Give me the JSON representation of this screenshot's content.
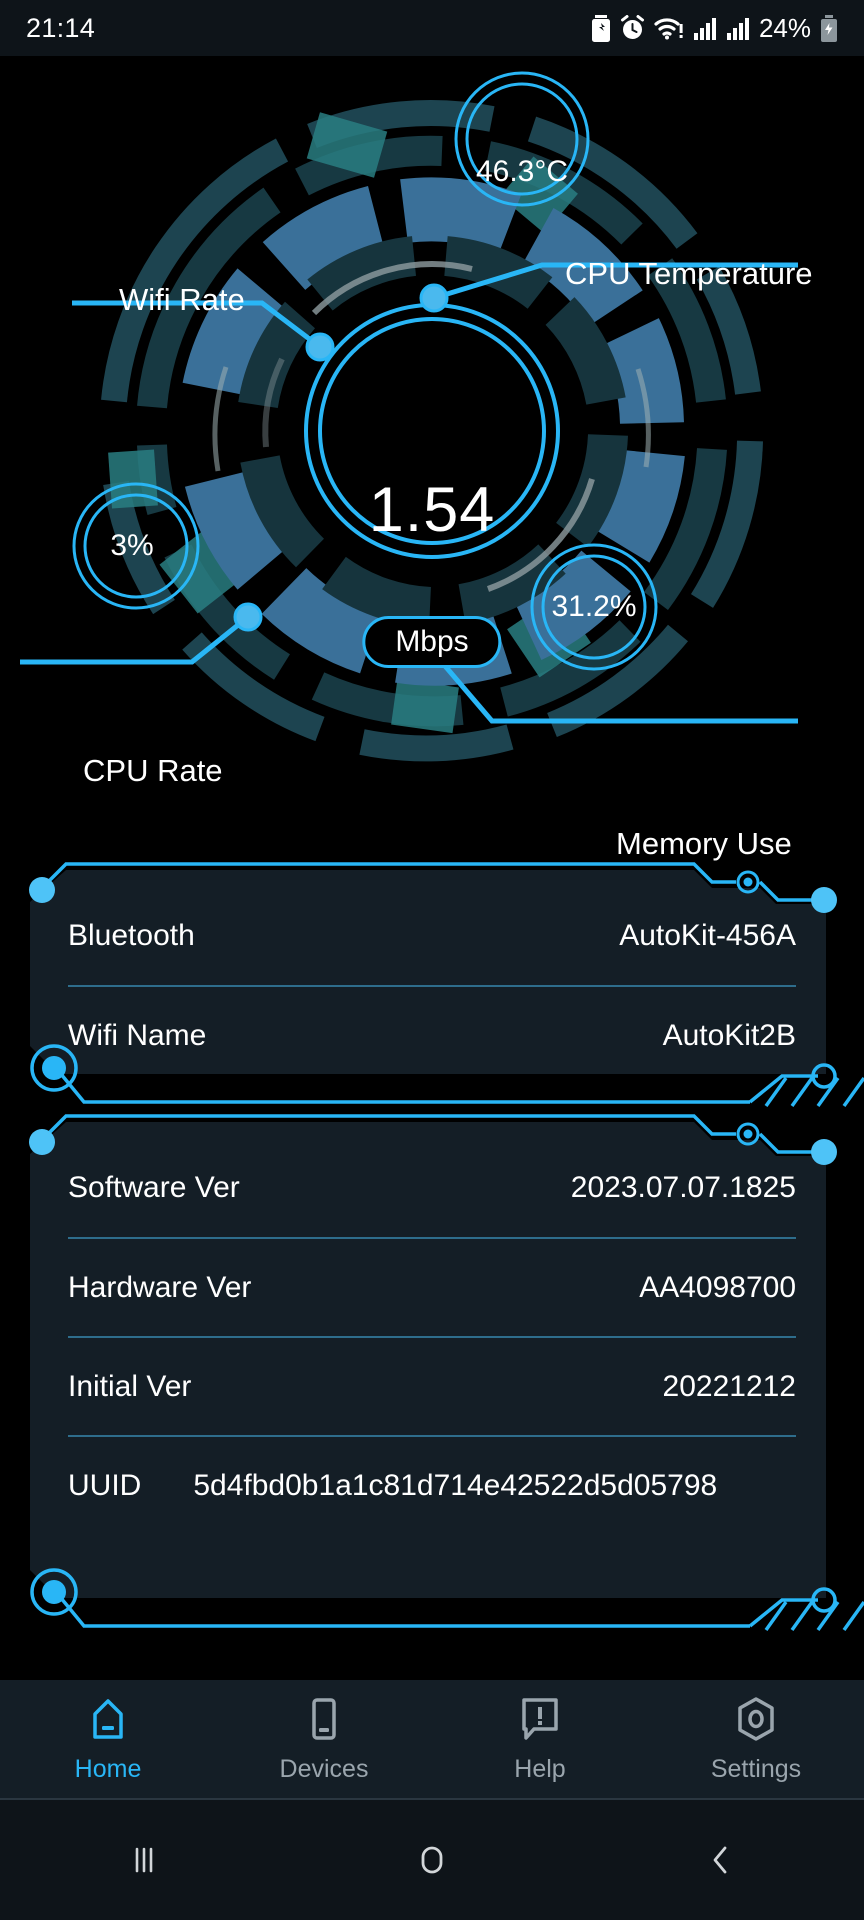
{
  "statusbar": {
    "time": "21:14",
    "battery_percent": "24%",
    "icons": [
      "battery-saver-icon",
      "alarm-icon",
      "wifi-alert-icon",
      "signal-bars-icon",
      "signal-bars-icon",
      "charging-battery-icon"
    ]
  },
  "gauge": {
    "center_value": "1.54",
    "center_unit": "Mbps",
    "metrics": [
      {
        "label": "Wifi Rate",
        "value": "1.54",
        "unit": "Mbps"
      },
      {
        "label": "CPU Temperature",
        "value": "46.3°C"
      },
      {
        "label": "CPU Rate",
        "value": "3%"
      },
      {
        "label": "Memory Use",
        "value": "31.2%"
      }
    ],
    "accent": "#29b6f6",
    "ring_blue": "#3a7099",
    "ring_teal": "#1d4450"
  },
  "cards": [
    {
      "rows": [
        {
          "key": "Bluetooth",
          "value": "AutoKit-456A"
        },
        {
          "key": "Wifi Name",
          "value": "AutoKit2B"
        }
      ]
    },
    {
      "rows": [
        {
          "key": "Software Ver",
          "value": "2023.07.07.1825"
        },
        {
          "key": "Hardware Ver",
          "value": "AA4098700"
        },
        {
          "key": "Initial Ver",
          "value": "20221212"
        },
        {
          "key": "UUID",
          "value": "5d4fbd0b1a1c81d714e42522d5d05798"
        }
      ]
    }
  ],
  "bottom_nav": {
    "items": [
      {
        "label": "Home",
        "icon": "home-icon",
        "active": true
      },
      {
        "label": "Devices",
        "icon": "phone-icon",
        "active": false
      },
      {
        "label": "Help",
        "icon": "help-icon",
        "active": false
      },
      {
        "label": "Settings",
        "icon": "settings-icon",
        "active": false
      }
    ]
  },
  "android_nav": {
    "items": [
      "recents-icon",
      "home-circle-icon",
      "back-icon"
    ]
  }
}
